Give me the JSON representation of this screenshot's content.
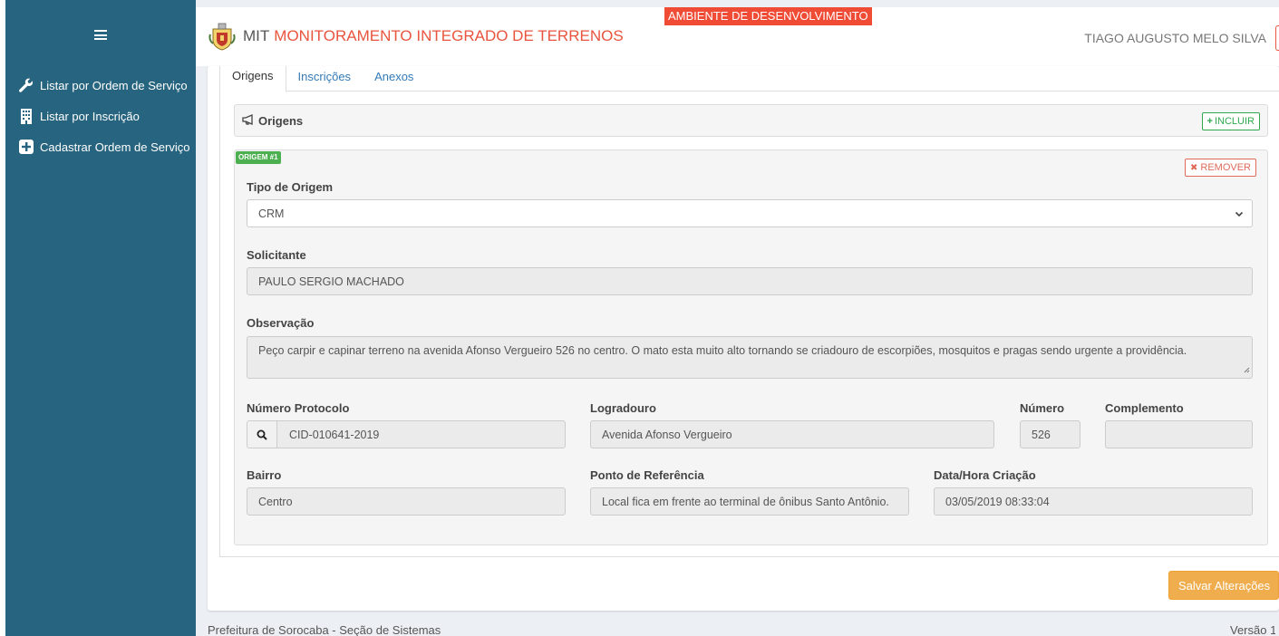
{
  "sidebar": {
    "items": [
      {
        "label": "Listar por Ordem de Serviço",
        "icon": "wrench-icon"
      },
      {
        "label": "Listar por Inscrição",
        "icon": "building-icon"
      },
      {
        "label": "Cadastrar Ordem de Serviço",
        "icon": "plus-square-icon"
      }
    ]
  },
  "header": {
    "app_prefix": "MIT",
    "app_name": "MONITORAMENTO INTEGRADO DE TERRENOS",
    "env_banner": "AMBIENTE DE DESENVOLVIMENTO",
    "user_name": "TIAGO AUGUSTO MELO SILVA"
  },
  "tabs": [
    {
      "label": "Origens",
      "active": true
    },
    {
      "label": "Inscrições",
      "active": false
    },
    {
      "label": "Anexos",
      "active": false
    }
  ],
  "origens_panel": {
    "title": "Origens",
    "add_label": "INCLUIR"
  },
  "origem": {
    "badge": "ORIGEM #1",
    "remove_label": "REMOVER",
    "tipo_label": "Tipo de Origem",
    "tipo_value": "CRM",
    "solicitante_label": "Solicitante",
    "solicitante_value": "PAULO SERGIO MACHADO",
    "observacao_label": "Observação",
    "observacao_value": "Peço carpir e capinar terreno na avenida Afonso Vergueiro 526 no centro. O mato esta muito alto tornando se criadouro de escorpiões, mosquitos e pragas sendo urgente a providência.",
    "protocolo_label": "Número Protocolo",
    "protocolo_value": "CID-010641-2019",
    "logradouro_label": "Logradouro",
    "logradouro_value": "Avenida Afonso Vergueiro",
    "numero_label": "Número",
    "numero_value": "526",
    "complemento_label": "Complemento",
    "complemento_value": "",
    "bairro_label": "Bairro",
    "bairro_value": "Centro",
    "referencia_label": "Ponto de Referência",
    "referencia_value": "Local fica em frente ao terminal de ônibus Santo Antônio.",
    "criacao_label": "Data/Hora Criação",
    "criacao_value": "03/05/2019 08:33:04"
  },
  "actions": {
    "save_label": "Salvar Alterações"
  },
  "footer": {
    "left": "Prefeitura de Sorocaba - Seção de Sistemas",
    "right": "Versão 1."
  },
  "colors": {
    "sidebar": "#27647f",
    "accent_red": "#e8543e",
    "success": "#2fa84f",
    "warning": "#f0ad4e"
  }
}
